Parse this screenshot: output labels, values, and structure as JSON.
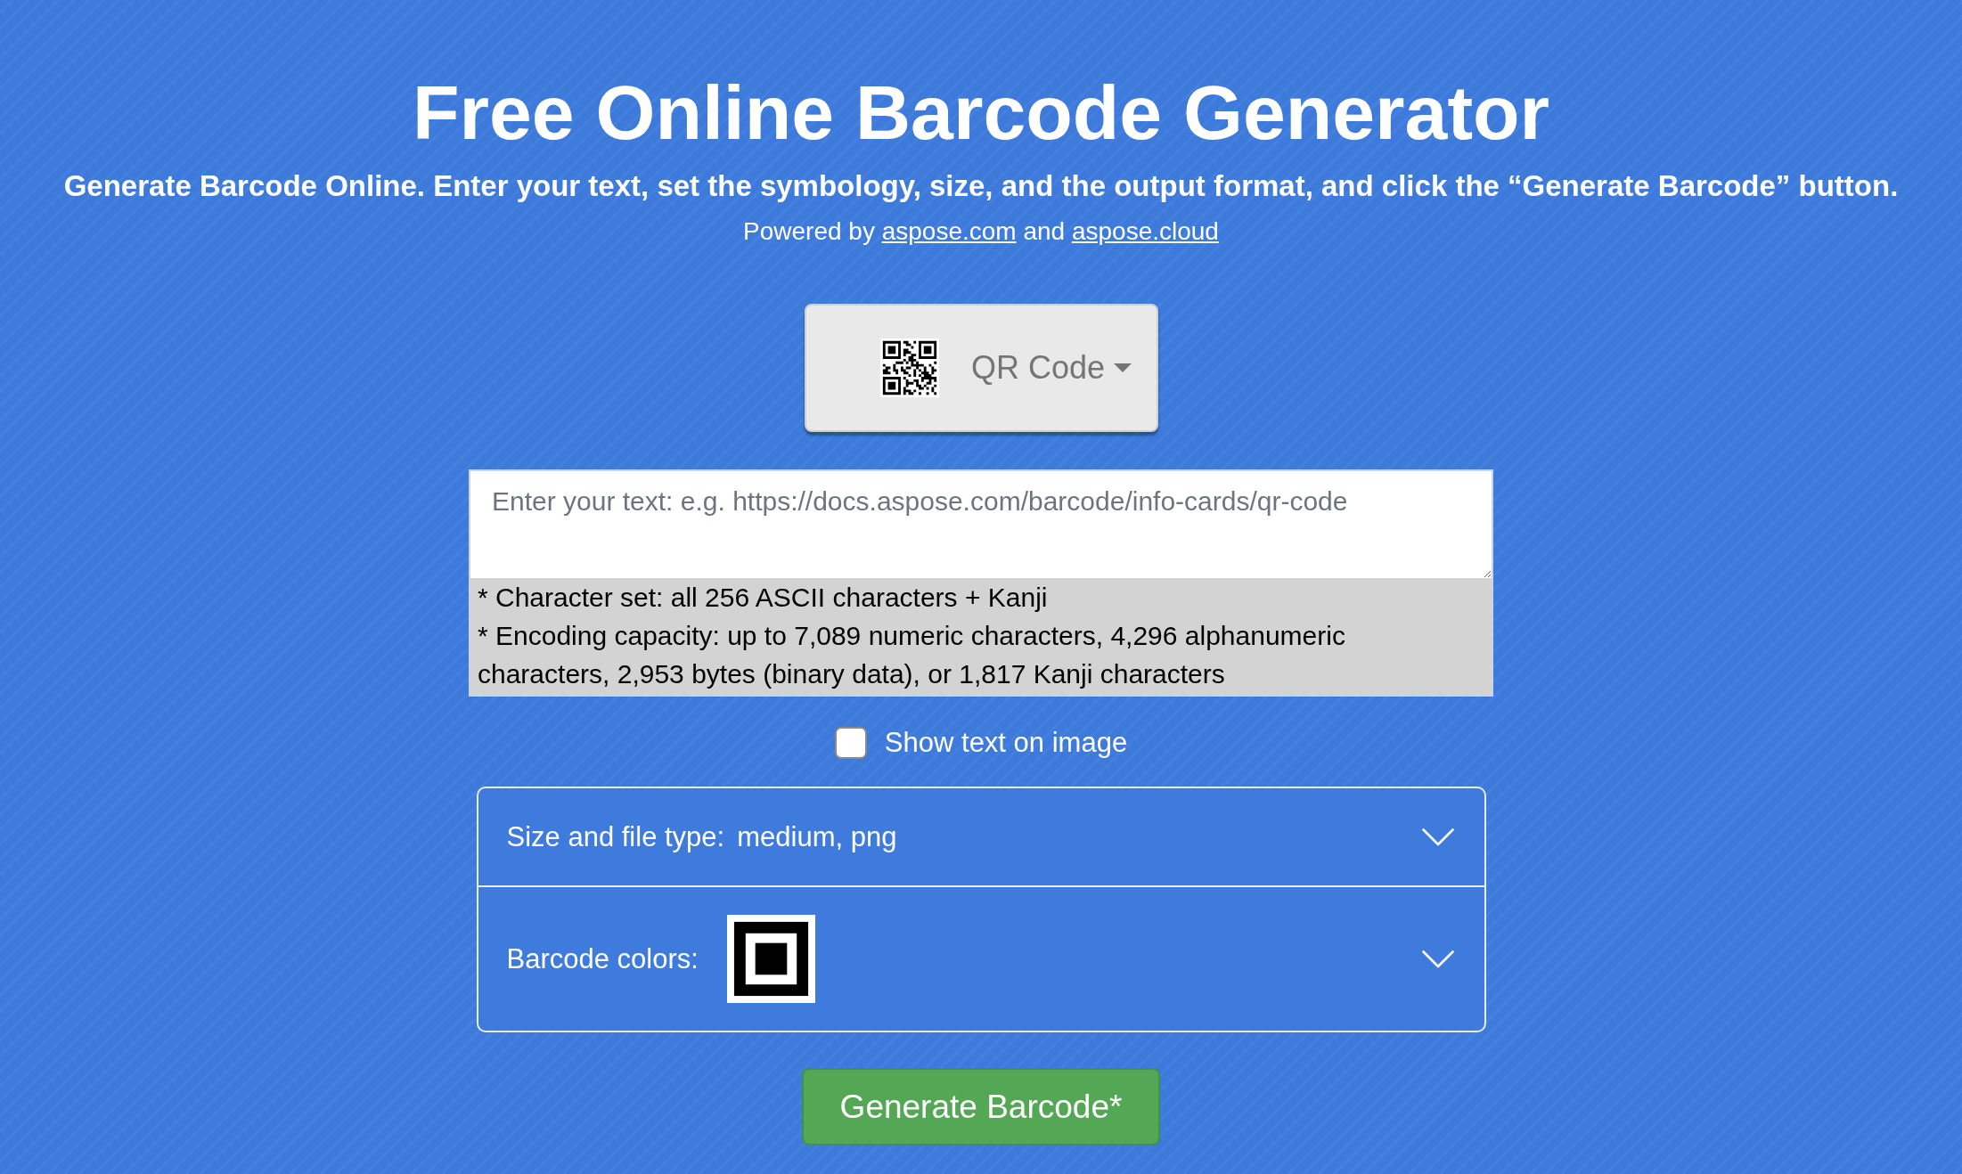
{
  "header": {
    "title": "Free Online Barcode Generator",
    "subtitle": "Generate Barcode Online. Enter your text, set the symbology, size, and the output format, and click the “Generate Barcode” button.",
    "powered_by": [
      {
        "kind": "text",
        "text": "Powered by"
      },
      {
        "kind": "link",
        "text": "aspose.com"
      },
      {
        "kind": "text",
        "text": "and"
      },
      {
        "kind": "link",
        "text": "aspose.cloud"
      }
    ]
  },
  "symbology_dropdown": {
    "label": "QR Code"
  },
  "text_input": {
    "placeholder": "Enter your text: e.g. https://docs.aspose.com/barcode/info-cards/qr-code"
  },
  "hints": [
    "* Character set: all 256 ASCII characters + Kanji",
    "* Encoding capacity: up to 7,089 numeric characters, 4,296 alphanumeric characters, 2,953 bytes (binary data), or 1,817 Kanji characters"
  ],
  "show_text_checkbox": {
    "label": "Show text on image",
    "checked": false
  },
  "settings": [
    {
      "kind": "text",
      "label": "Size and file type:",
      "value": "medium, png",
      "expanded": false
    },
    {
      "kind": "swatch",
      "label": "Barcode colors:",
      "expanded": false
    }
  ],
  "generate_button": {
    "label": "Generate Barcode*"
  }
}
